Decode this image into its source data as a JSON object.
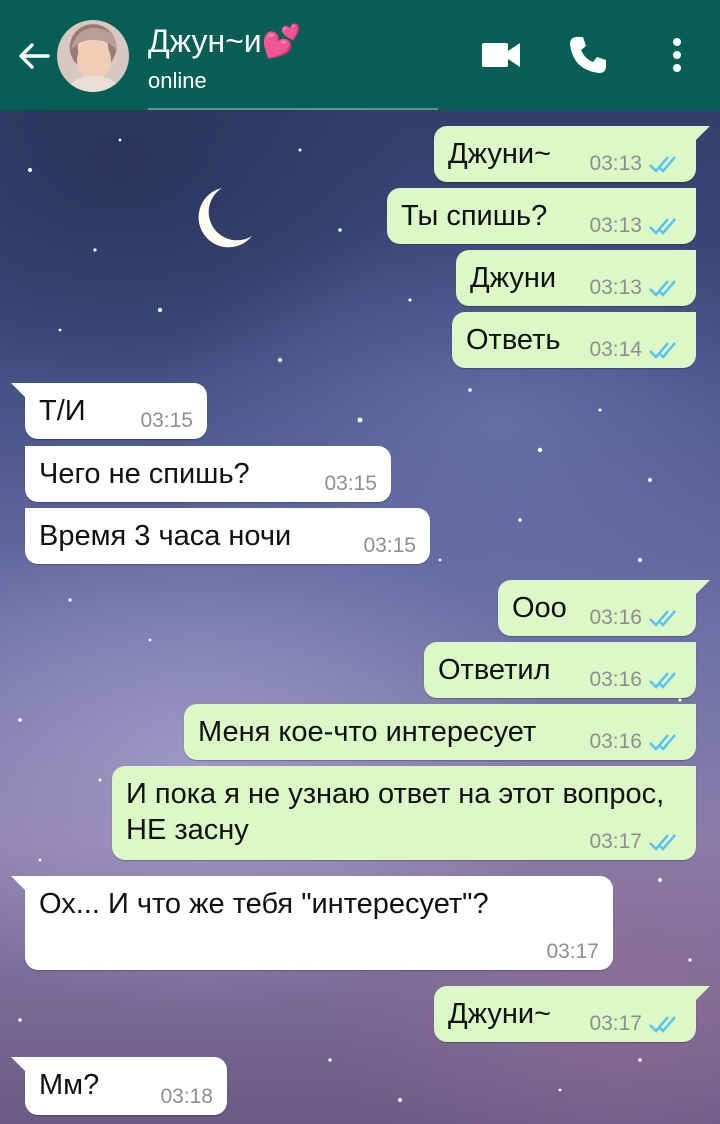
{
  "header": {
    "title": "Джун~и💕",
    "status": "online",
    "icons": [
      "back-arrow-icon",
      "video-call-icon",
      "phone-icon",
      "more-vert-icon"
    ]
  },
  "colors": {
    "header_bg": "#075e54",
    "outgoing_bubble": "#dcf8c6",
    "incoming_bubble": "#ffffff",
    "read_ticks": "#4fc3f7"
  },
  "messages": [
    {
      "dir": "out",
      "text": "Джуни~",
      "time": "03:13",
      "read": true
    },
    {
      "dir": "out",
      "text": "Ты спишь?",
      "time": "03:13",
      "read": true
    },
    {
      "dir": "out",
      "text": "Джуни",
      "time": "03:13",
      "read": true
    },
    {
      "dir": "out",
      "text": "Ответь",
      "time": "03:14",
      "read": true
    },
    {
      "dir": "in",
      "text": "Т/И",
      "time": "03:15"
    },
    {
      "dir": "in",
      "text": "Чего не спишь?",
      "time": "03:15"
    },
    {
      "dir": "in",
      "text": "Время 3 часа ночи",
      "time": "03:15"
    },
    {
      "dir": "out",
      "text": "Ооо",
      "time": "03:16",
      "read": true
    },
    {
      "dir": "out",
      "text": "Ответил",
      "time": "03:16",
      "read": true
    },
    {
      "dir": "out",
      "text": "Меня кое-что интересует",
      "time": "03:16",
      "read": true
    },
    {
      "dir": "out",
      "text": "И пока я не узнаю ответ на этот вопрос, НЕ засну",
      "time": "03:17",
      "read": true
    },
    {
      "dir": "in",
      "text": "Ох... И что же тебя \"интересует\"?",
      "time": "03:17"
    },
    {
      "dir": "out",
      "text": "Джуни~",
      "time": "03:17",
      "read": true
    },
    {
      "dir": "in",
      "text": "Мм?",
      "time": "03:18"
    }
  ]
}
